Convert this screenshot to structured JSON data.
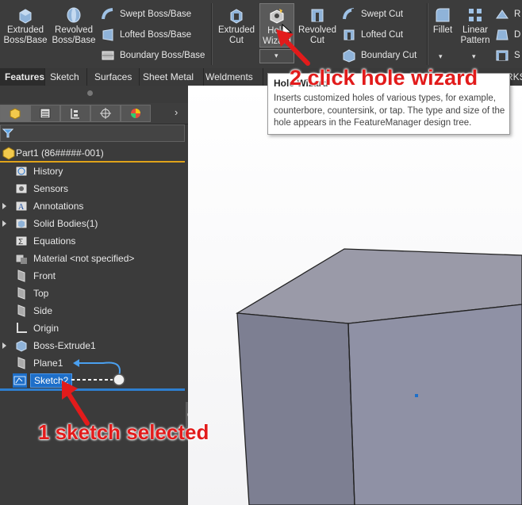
{
  "ribbon": {
    "extruded_boss": "Extruded Boss/Base",
    "revolved_boss": "Revolved Boss/Base",
    "swept_boss": "Swept Boss/Base",
    "lofted_boss": "Lofted Boss/Base",
    "boundary_boss": "Boundary Boss/Base",
    "extruded_cut": "Extruded Cut",
    "hole_wizard": "Hole Wizard",
    "revolved_cut": "Revolved Cut",
    "swept_cut": "Swept Cut",
    "lofted_cut": "Lofted Cut",
    "boundary_cut": "Boundary Cut",
    "fillet": "Fillet",
    "linear_pattern": "Linear Pattern",
    "rib_partial": "R",
    "draft_partial": "D",
    "shell_partial": "S"
  },
  "tabs": [
    "Features",
    "Sketch",
    "Surfaces",
    "Sheet Metal",
    "Weldments"
  ],
  "tab_overflow_partial": "RKS",
  "tooltip": {
    "title": "Hole Wizard",
    "body": "Inserts customized holes of various types, for example, counterbore, countersink, or tap. The type and size of the hole appears in the FeatureManager design tree."
  },
  "tree": {
    "root": "Part1 (86#####-001)",
    "items": [
      {
        "label": "History",
        "icon": "history-icon"
      },
      {
        "label": "Sensors",
        "icon": "sensors-icon"
      },
      {
        "label": "Annotations",
        "icon": "annotations-icon"
      },
      {
        "label": "Solid Bodies(1)",
        "icon": "solid-bodies-icon"
      },
      {
        "label": "Equations",
        "icon": "equations-icon"
      },
      {
        "label": "Material <not specified>",
        "icon": "material-icon"
      },
      {
        "label": "Front",
        "icon": "plane-icon"
      },
      {
        "label": "Top",
        "icon": "plane-icon"
      },
      {
        "label": "Side",
        "icon": "plane-icon"
      },
      {
        "label": "Origin",
        "icon": "origin-icon"
      },
      {
        "label": "Boss-Extrude1",
        "icon": "extrude-icon"
      },
      {
        "label": "Plane1",
        "icon": "plane-icon"
      },
      {
        "label": "Sketch2",
        "icon": "sketch-icon"
      }
    ]
  },
  "annotations": {
    "step1": "1  sketch selected",
    "step2": "2 click hole wizard"
  },
  "colors": {
    "annotation": "#e21b1b",
    "selection": "#1e6fc9",
    "rollback_bar": "#2e7fd0"
  }
}
